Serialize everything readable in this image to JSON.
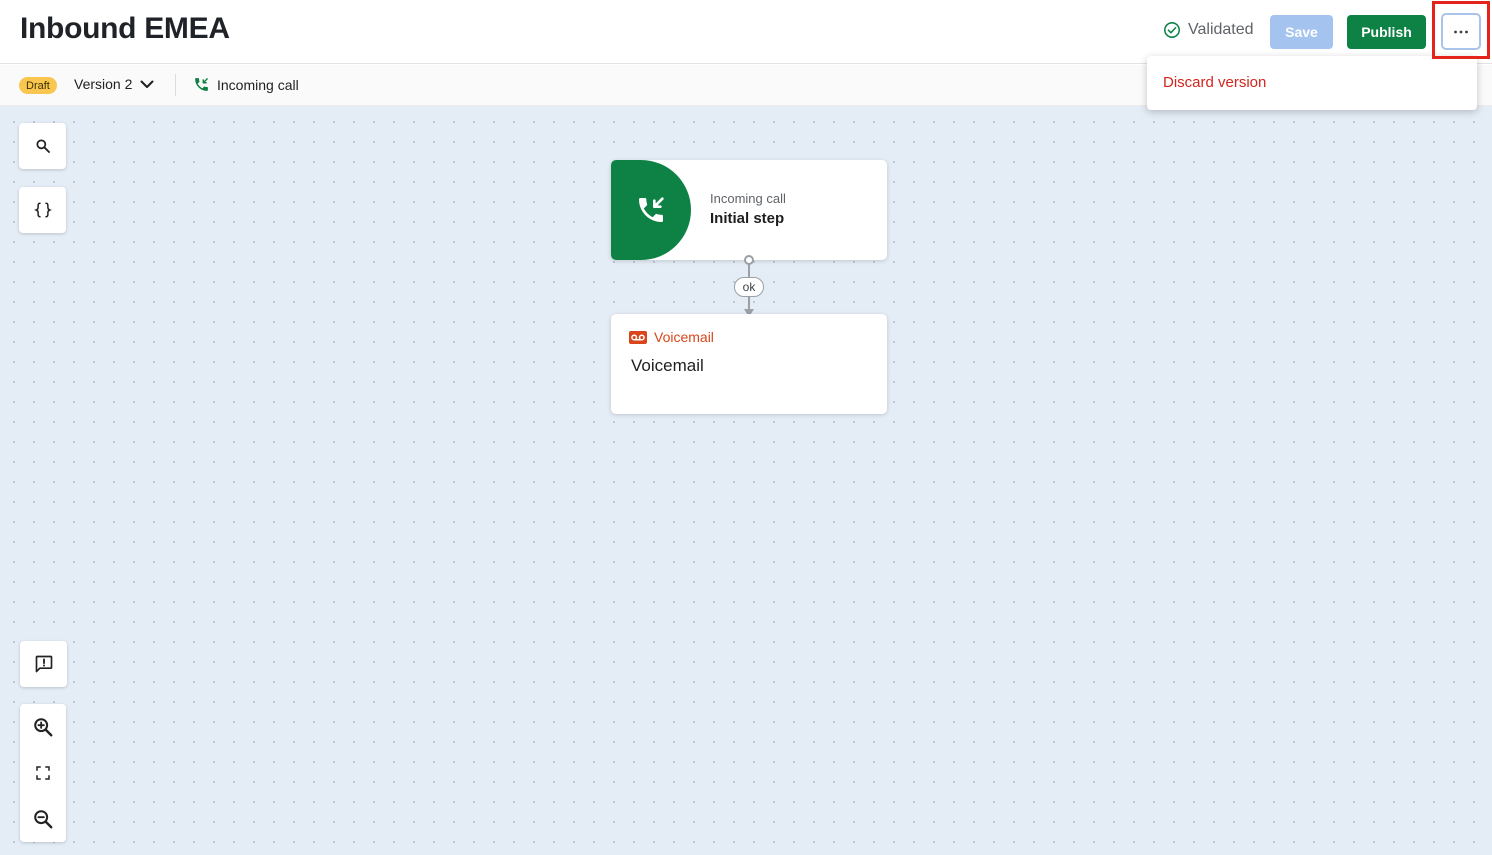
{
  "header": {
    "title": "Inbound EMEA",
    "status_label": "Validated",
    "save_label": "Save",
    "publish_label": "Publish",
    "more_icon": "more-horizontal-icon"
  },
  "toolbar": {
    "status_badge": "Draft",
    "version_label": "Version 2",
    "trigger_label": "Incoming call"
  },
  "menu": {
    "items": [
      {
        "label": "Discard version",
        "color": "#d0261d"
      }
    ]
  },
  "flow": {
    "nodes": [
      {
        "type_label": "Incoming call",
        "title": "Initial step",
        "icon": "incoming-call-icon",
        "color": "#0e8145"
      },
      {
        "type_label": "Voicemail",
        "title": "Voicemail",
        "icon": "voicemail-icon",
        "color": "#d8461b"
      }
    ],
    "edges": [
      {
        "label": "ok"
      }
    ]
  },
  "canvas_tools": {
    "top": [
      "search-icon",
      "variables-icon"
    ],
    "bottom": [
      "feedback-icon",
      "zoom-in-icon",
      "fit-view-icon",
      "zoom-out-icon"
    ]
  },
  "colors": {
    "primary": "#0e8145",
    "save_disabled": "#a4c4ef",
    "danger": "#d0261d",
    "canvas_bg": "#e4ecf6",
    "draft_badge": "#f9c74f"
  }
}
